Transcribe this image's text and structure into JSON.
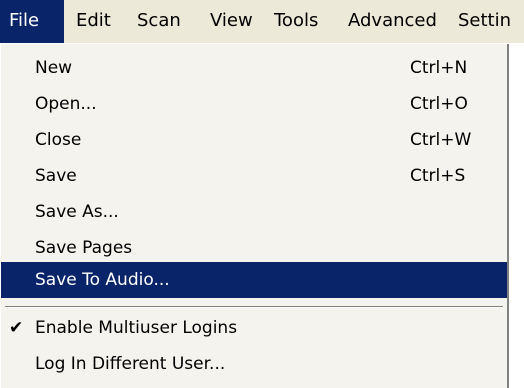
{
  "menubar": {
    "items": [
      "File",
      "Edit",
      "Scan",
      "View",
      "Tools",
      "Advanced",
      "Settin"
    ],
    "active": "File"
  },
  "file_menu": {
    "items": [
      {
        "label": "New",
        "shortcut": "Ctrl+N"
      },
      {
        "label": "Open...",
        "shortcut": "Ctrl+O"
      },
      {
        "label": "Close",
        "shortcut": "Ctrl+W"
      },
      {
        "label": "Save",
        "shortcut": "Ctrl+S"
      },
      {
        "label": "Save As...",
        "shortcut": ""
      },
      {
        "label": "Save Pages",
        "shortcut": ""
      },
      {
        "label": "Save To Audio...",
        "shortcut": "",
        "selected": true
      },
      {
        "label": "Enable Multiuser Logins",
        "shortcut": "",
        "checked": true
      },
      {
        "label": "Log In Different User...",
        "shortcut": ""
      }
    ]
  },
  "colors": {
    "menubar_bg": "#ece9d8",
    "highlight": "#0a246a",
    "menu_bg": "#f4f3ee"
  },
  "icons": {
    "checkmark": "checkmark-icon"
  }
}
